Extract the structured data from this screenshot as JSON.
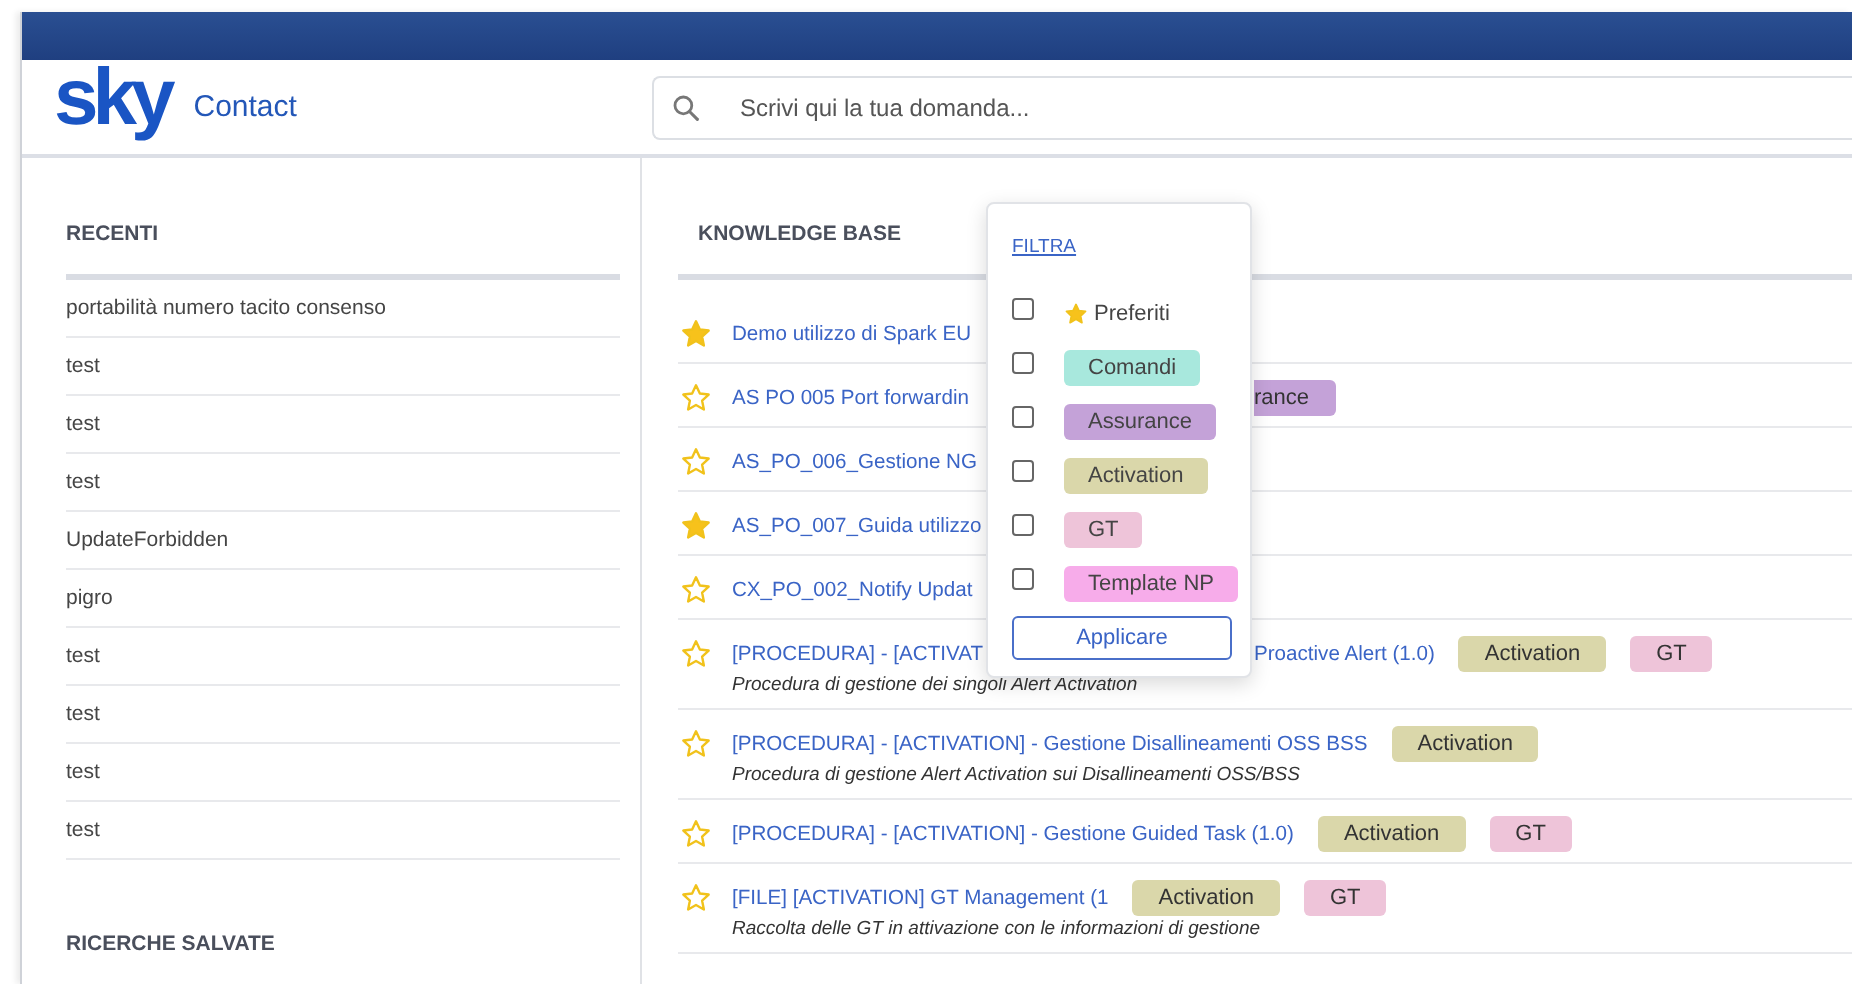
{
  "header": {
    "logo": "sky",
    "app_name": "Contact"
  },
  "search": {
    "placeholder": "Scrivi qui la tua domanda..."
  },
  "recent": {
    "title": "RECENTI",
    "items": [
      "portabilità numero tacito consenso",
      "test",
      "test",
      "test",
      "UpdateForbidden",
      "pigro",
      "test",
      "test",
      "test",
      "test"
    ]
  },
  "saved_searches": {
    "title": "RICERCHE SALVATE"
  },
  "knowledge_base": {
    "title": "KNOWLEDGE BASE",
    "rows": [
      {
        "favorite": true,
        "title": "Demo utilizzo di Spark EU",
        "covered": true,
        "title_end": "",
        "tags": []
      },
      {
        "favorite": false,
        "title": "AS PO 005 Port forwardin",
        "covered": true,
        "title_end": "",
        "tags": [
          {
            "label": "rance",
            "color": "#c4a2d8",
            "cut": true
          }
        ]
      },
      {
        "favorite": false,
        "title": "AS_PO_006_Gestione NG",
        "covered": true,
        "title_end": "",
        "tags": []
      },
      {
        "favorite": true,
        "title": "AS_PO_007_Guida utilizzo",
        "covered": true,
        "title_end": "",
        "tags": []
      },
      {
        "favorite": false,
        "title": "CX_PO_002_Notify Updat",
        "covered": true,
        "title_end": "",
        "tags": []
      },
      {
        "favorite": false,
        "title": "[PROCEDURA] - [ACTIVAT",
        "covered": true,
        "title_end": "Proactive Alert (1.0)",
        "tags": [
          {
            "label": "Activation",
            "color": "#dad7aa",
            "cut": false
          },
          {
            "label": "GT",
            "color": "#eec4d9",
            "cut": false
          }
        ],
        "description": "Procedura di gestione dei singoli Alert Activation"
      },
      {
        "favorite": false,
        "title": "[PROCEDURA] - [ACTIVATION] - Gestione Disallineamenti OSS BSS",
        "covered": false,
        "title_end": "",
        "tags": [
          {
            "label": "Activation",
            "color": "#dad7aa",
            "cut": false
          }
        ],
        "description": "Procedura di gestione Alert Activation sui Disallineamenti OSS/BSS"
      },
      {
        "favorite": false,
        "title": "[PROCEDURA] - [ACTIVATION] - Gestione Guided Task (1.0)",
        "covered": false,
        "title_end": "",
        "tags": [
          {
            "label": "Activation",
            "color": "#dad7aa",
            "cut": false
          },
          {
            "label": "GT",
            "color": "#eec4d9",
            "cut": false
          }
        ]
      },
      {
        "favorite": false,
        "title": "[FILE] [ACTIVATION] GT Management (1",
        "covered": false,
        "title_end": "",
        "tags": [
          {
            "label": "Activation",
            "color": "#dad7aa",
            "cut": false
          },
          {
            "label": "GT",
            "color": "#eec4d9",
            "cut": false
          }
        ],
        "description": "Raccolta delle GT in attivazione con le informazioni di gestione"
      }
    ]
  },
  "filter_popup": {
    "title": "FILTRA",
    "options": [
      {
        "kind": "favorites",
        "label": "Preferiti",
        "checked": false
      },
      {
        "kind": "tag",
        "label": "Comandi",
        "color": "#a8e8dd",
        "checked": false
      },
      {
        "kind": "tag",
        "label": "Assurance",
        "color": "#c4a2d8",
        "checked": false
      },
      {
        "kind": "tag",
        "label": "Activation",
        "color": "#dad7aa",
        "checked": false
      },
      {
        "kind": "tag",
        "label": "GT",
        "color": "#eec4d9",
        "checked": false
      },
      {
        "kind": "tag",
        "label": "Template NP",
        "color": "#f7acea",
        "checked": false
      }
    ],
    "apply_button": "Applicare"
  }
}
